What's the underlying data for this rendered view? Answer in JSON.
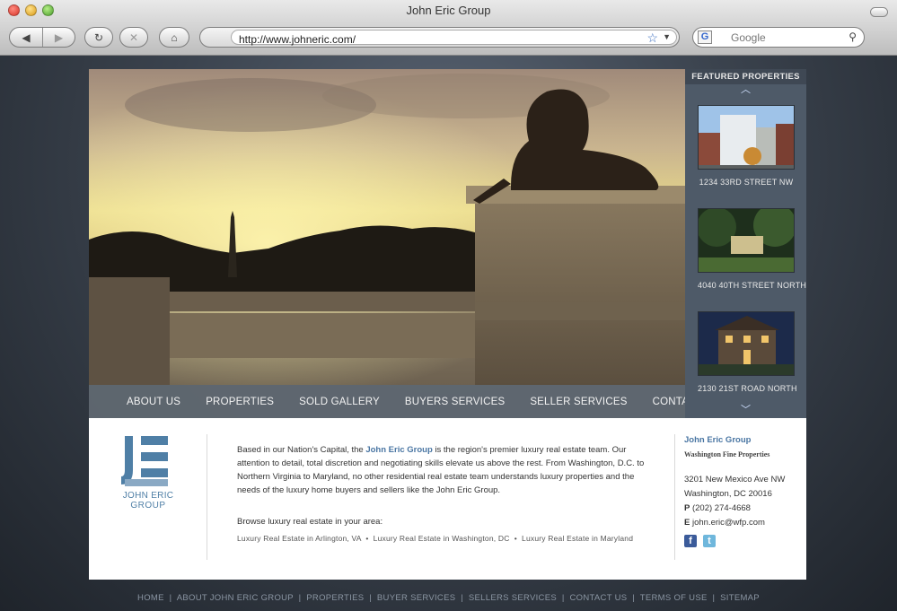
{
  "browser": {
    "window_title": "John Eric Group",
    "url": "http://www.johneric.com/",
    "search_placeholder": "Google",
    "search_engine_badge": "G"
  },
  "main_nav": [
    "ABOUT US",
    "PROPERTIES",
    "SOLD GALLERY",
    "BUYERS SERVICES",
    "SELLER SERVICES",
    "CONTACT US"
  ],
  "featured": {
    "title": "FEATURED PROPERTIES",
    "items": [
      {
        "label": "1234 33RD STREET NW"
      },
      {
        "label": "4040 40TH STREET NORTH"
      },
      {
        "label": "2130 21ST ROAD NORTH"
      }
    ]
  },
  "logo": {
    "name": "JOHN ERIC",
    "sub": "GROUP"
  },
  "intro": {
    "before": "Based in our Nation's Capital, the ",
    "highlight": "John Eric Group",
    "after": " is the region's premier luxury real estate team. Our attention to detail, total discretion and negotiating skills elevate us above the rest. From Washington, D.C. to Northern Virginia to Maryland, no other residential real estate team understands luxury properties and the needs of the luxury home buyers and sellers like the John Eric Group."
  },
  "browse": {
    "heading": "Browse luxury real estate in your area:",
    "link1": "Luxury Real Estate in Arlington, VA",
    "link2": "Luxury Real Estate in Washington, DC",
    "link3": "Luxury Real Estate in Maryland",
    "sep": "•"
  },
  "contact": {
    "title": "John Eric Group",
    "subtitle": "Washington Fine Properties",
    "address1": "3201 New Mexico Ave NW",
    "address2": "Washington, DC 20016",
    "phone_label": "P",
    "phone": "(202) 274-4668",
    "email_label": "E",
    "email": "john.eric@wfp.com"
  },
  "footer_links": [
    "HOME",
    "ABOUT JOHN ERIC GROUP",
    "PROPERTIES",
    "BUYER SERVICES",
    "SELLERS SERVICES",
    "CONTACT US",
    "TERMS OF USE",
    "SITEMAP"
  ],
  "icons": {
    "nav_back": "◀",
    "nav_forward": "▶",
    "reload": "↻",
    "stop": "✕",
    "home": "⌂",
    "bookmark_star": "☆",
    "dropdown": "▼",
    "search": "⚲",
    "arrow_up": "︿",
    "arrow_down": "﹀",
    "facebook": "f",
    "twitter": "t"
  },
  "colors": {
    "accent": "#4a76a3",
    "nav_bar": "#606871",
    "featured_bg": "#4e5a68"
  }
}
